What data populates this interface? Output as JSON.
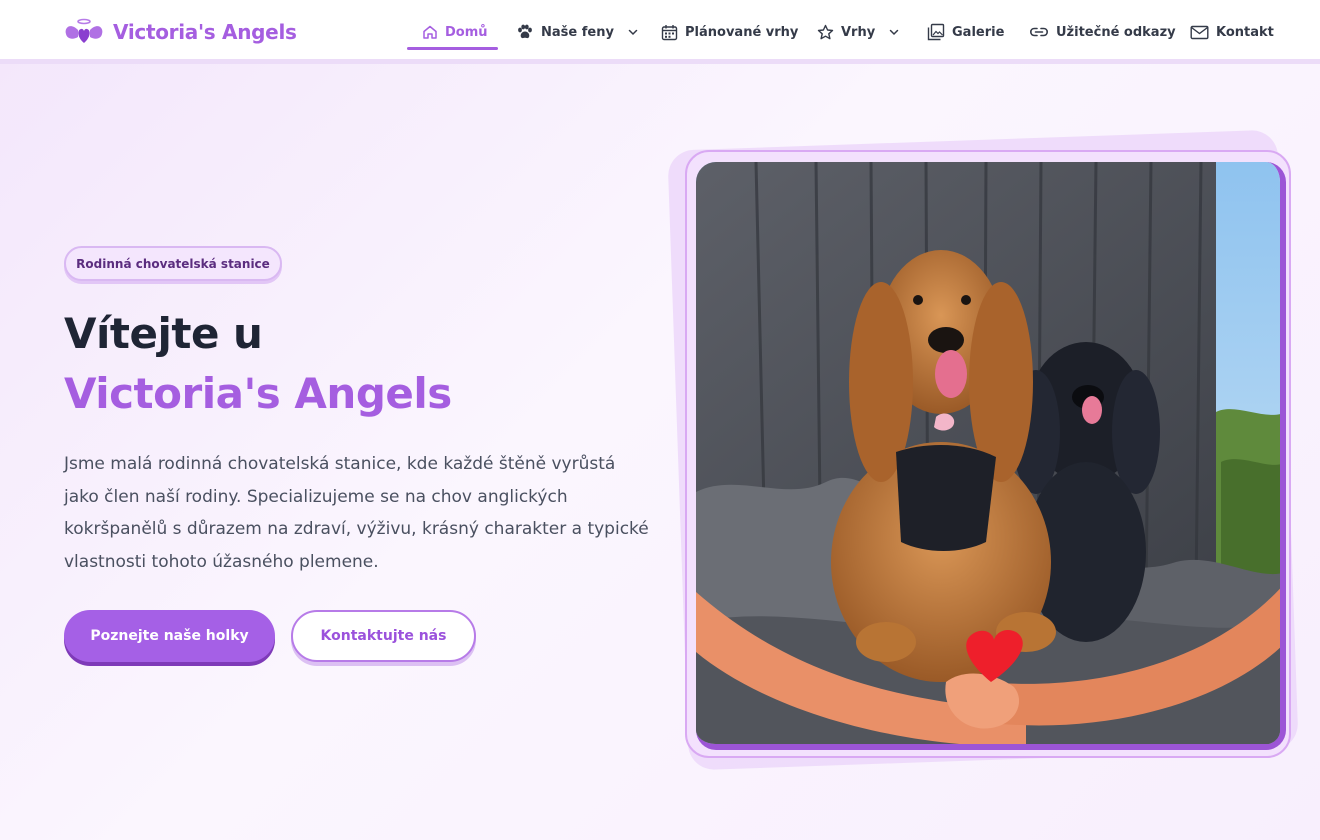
{
  "brand": {
    "name": "Victoria's Angels",
    "logo_icon": "angel-wings-heart-icon"
  },
  "nav": {
    "items": [
      {
        "label": "Domů",
        "icon": "home-icon",
        "active": true,
        "dropdown": false
      },
      {
        "label": "Naše feny",
        "icon": "paw-icon",
        "active": false,
        "dropdown": true
      },
      {
        "label": "Plánované vrhy",
        "icon": "calendar-icon",
        "active": false,
        "dropdown": false
      },
      {
        "label": "Vrhy",
        "icon": "star-icon",
        "active": false,
        "dropdown": true
      },
      {
        "label": "Galerie",
        "icon": "gallery-icon",
        "active": false,
        "dropdown": false
      },
      {
        "label": "Užitečné odkazy",
        "icon": "link-icon",
        "active": false,
        "dropdown": false
      },
      {
        "label": "Kontakt",
        "icon": "mail-icon",
        "active": false,
        "dropdown": false
      }
    ]
  },
  "hero": {
    "badge": "Rodinná chovatelská stanice",
    "title_line1": "Vítejte u",
    "title_line2": "Victoria's Angels",
    "description": "Jsme malá rodinná chovatelská stanice, kde každé štěně vyrůstá jako člen naší rodiny. Specializujeme se na chov anglických kokršpanělů s důrazem na zdraví, výživu, krásný charakter a typické vlastnosti tohoto úžasného plemene.",
    "primary_button": "Poznejte naše holky",
    "secondary_button": "Kontaktujte nás",
    "image_icon": "two-cocker-spaniels-photo"
  },
  "colors": {
    "accent": "#a55ee0",
    "accent_dark": "#7e3ab8",
    "text_dark": "#1f2535",
    "text_body": "#4a5060",
    "badge_bg": "#f4e6fd"
  }
}
